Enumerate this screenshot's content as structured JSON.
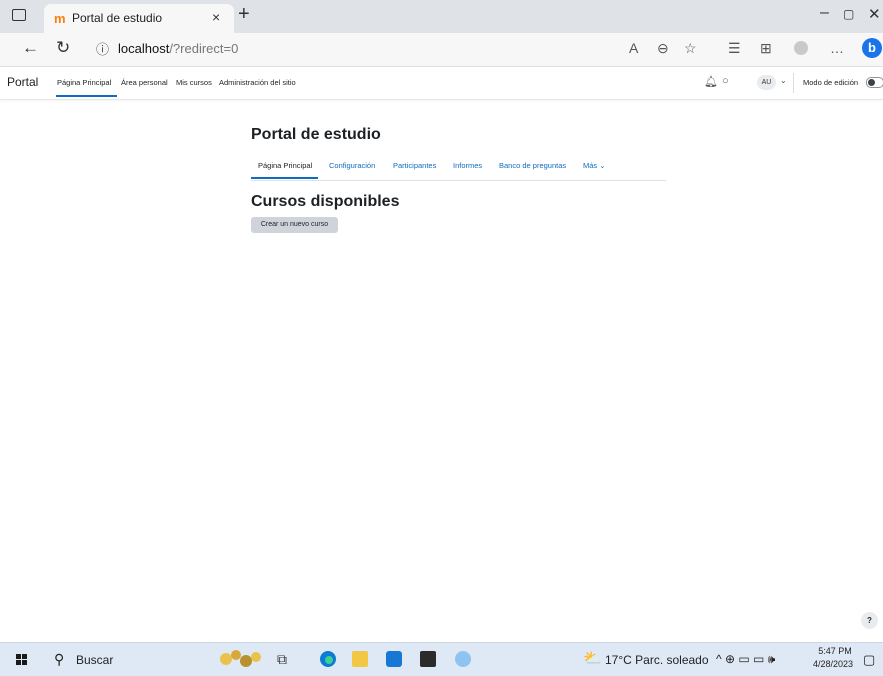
{
  "browser": {
    "tab_title": "Portal de estudio",
    "tab_favicon": "moodle-icon",
    "tab_close": "×",
    "new_tab": "+",
    "url_host": "localhost",
    "url_path": "/?redirect=0",
    "window": {
      "minimize": "–",
      "restore": "▢",
      "close": "✕"
    }
  },
  "moodle_nav": {
    "brand": "Portal",
    "items": [
      "Página Principal",
      "Área personal",
      "Mis cursos",
      "Administración del sitio"
    ],
    "active": "Página Principal",
    "user_initials": "AU",
    "edit_mode_label": "Modo de edición",
    "edit_mode_on": false
  },
  "page": {
    "title": "Portal de estudio",
    "course_nav": [
      "Página Principal",
      "Configuración",
      "Participantes",
      "Informes",
      "Banco de preguntas",
      "Más ⌄"
    ],
    "section_title": "Cursos disponibles",
    "new_course_button": "Crear un nuevo curso",
    "help": "?"
  },
  "taskbar": {
    "search_label": "Buscar",
    "weather": "17°C  Parc. soleado",
    "time": "5:47 PM",
    "date": "4/28/2023"
  },
  "colors": {
    "accent": "#0f6cbf",
    "brand_orange": "#f98012"
  }
}
